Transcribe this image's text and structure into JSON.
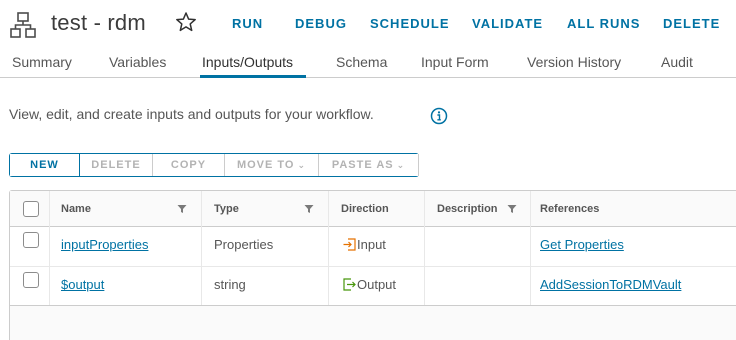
{
  "header": {
    "title": "test - rdm",
    "actions": [
      "RUN",
      "DEBUG",
      "SCHEDULE",
      "VALIDATE",
      "ALL RUNS",
      "DELETE"
    ]
  },
  "tabs": [
    "Summary",
    "Variables",
    "Inputs/Outputs",
    "Schema",
    "Input Form",
    "Version History",
    "Audit"
  ],
  "active_tab": "Inputs/Outputs",
  "description": "View, edit, and create inputs and outputs for your workflow.",
  "toolbar": {
    "new": "NEW",
    "delete": "DELETE",
    "copy": "COPY",
    "move_to": "MOVE TO",
    "paste_as": "PASTE AS"
  },
  "grid": {
    "columns": [
      "Name",
      "Type",
      "Direction",
      "Description",
      "References"
    ],
    "rows": [
      {
        "name": "inputProperties",
        "type": "Properties",
        "direction": "Input",
        "description": "",
        "references": "Get Properties"
      },
      {
        "name": "$output",
        "type": "string",
        "direction": "Output",
        "description": "",
        "references": "AddSessionToRDMVault"
      }
    ]
  },
  "colors": {
    "accent": "#0072a3",
    "input_icon": "#e57200",
    "output_icon": "#48960c"
  }
}
